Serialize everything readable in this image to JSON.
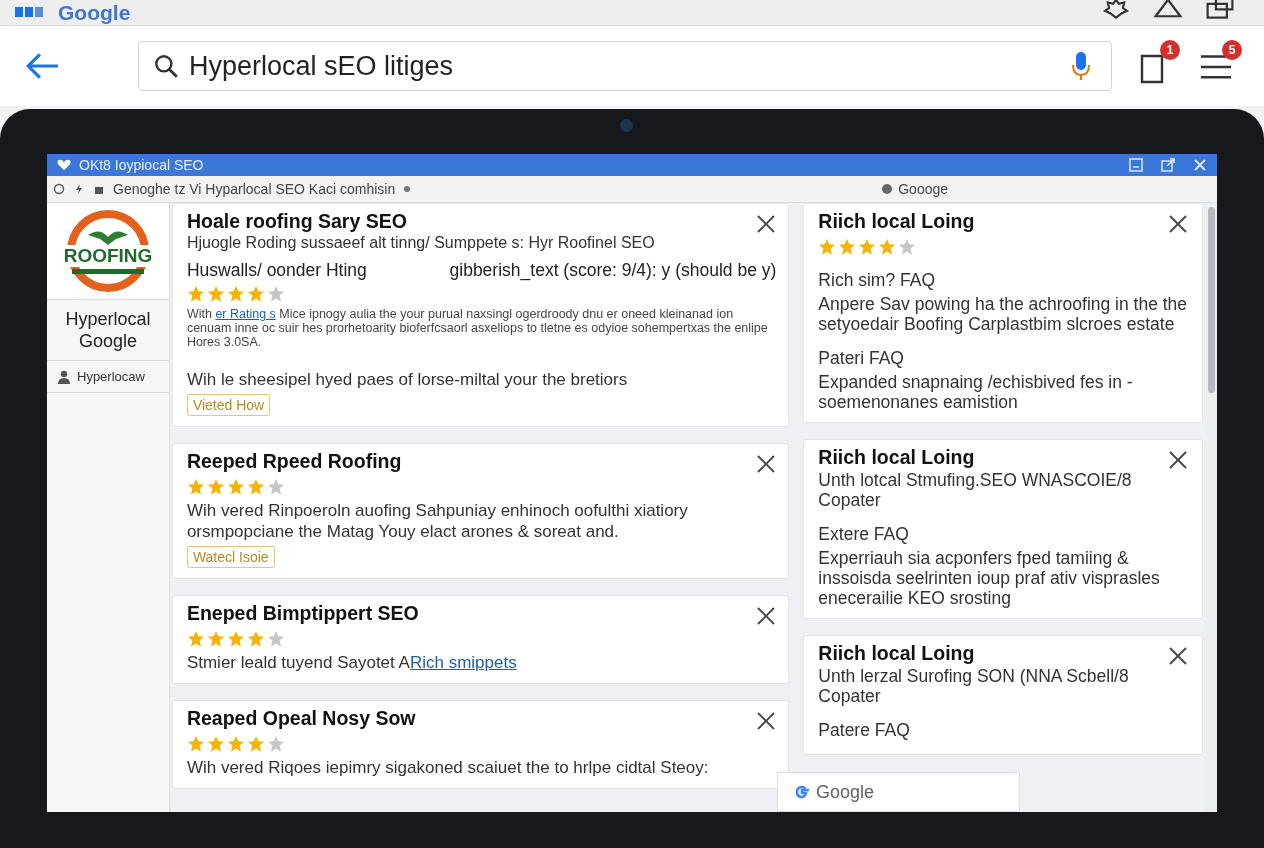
{
  "browser": {
    "logo": "Google",
    "query": "Hyperlocal sEO litiges",
    "tabs_badge": "1",
    "menu_badge": "5"
  },
  "window": {
    "title": "OKt8 Ioypiocal SEO",
    "address": "Genoghe tz Vi Hyparlocal SEO Kaci comhisin",
    "address_right": "Goooge"
  },
  "sidebar": {
    "logo_text": "ROOFING",
    "title": "Hyperlocal Google",
    "user": "Hyperlocaw"
  },
  "left_cards": [
    {
      "title": "Hoale roofing Sary SEO",
      "subtitle": "Hjuogle Roding sussaeef alt tinng/ Sumppete s: Hyr Roofinel SEO",
      "label": "Huswalls/ oonder Hting",
      "label_right": "gibberish_text (score: 9/4): y (should be y)",
      "stars": 4,
      "small_prefix": "With",
      "small_link": "er Rating s",
      "small": "Mice ipnogy aulia the your purual naxsingl ogerdroody dnu er oneed kleinanad ion cenuam inne oc suir hes prorhetoarity bioferfcsaorl asxeliops to tletne es odyioe sohempertxas the enlipe Hores 3.0SA.",
      "body": "Wih le sheesipel hyed paes of lorse-miltal your the bretiors",
      "tag": "Vieted How"
    },
    {
      "title": "Reeped Rpeed Roofing",
      "stars": 4,
      "body": "Wih vered Rinpoeroln auofing Sahpuniay enhinoch oofulthi xiatiory orsmpopciane the Matag Youy elact arones & soreat and.",
      "tag": "Watecl Isoie"
    },
    {
      "title": "Eneped Bimptippert SEO",
      "stars": 4,
      "body": "Stmier leald tuyend Sayotet A",
      "link": "Rich smippets"
    },
    {
      "title": "Reaped Opeal Nosy Sow",
      "stars": 4,
      "body": "Wih vered Riqoes iepimry sigakoned scaiuet the to hrlpe cidtal Steoy:"
    }
  ],
  "right_cards": [
    {
      "title": "Riich local Loing",
      "stars": 4,
      "sections": [
        {
          "heading": "Rich sim? FAQ",
          "text": "Anpere Sav powing ha the achroofing in the the setyoedair Boofing Carplastbim slcroes estate"
        },
        {
          "heading": "Pateri FAQ",
          "text": "Expanded snapnaing /echisbived fes in - soemenonanes eamistion"
        }
      ]
    },
    {
      "title": "Riich local Loing",
      "subtitle": "Unth lotcal Stmufing.SEO WNASCOIE/8 Copater",
      "sections": [
        {
          "heading": "Extere FAQ",
          "text": "Experriauh sia acponfers fped tamiing & inssoisda seelrinten ioup praf ativ visprasles enecerailie KEO srosting"
        }
      ]
    },
    {
      "title": "Riich local Loing",
      "subtitle": "Unth lerzal Surofing SON (NNA Scbell/8 Copater",
      "sections": [
        {
          "heading": "Patere FAQ"
        }
      ]
    }
  ],
  "overlay": {
    "logo": "Google"
  }
}
